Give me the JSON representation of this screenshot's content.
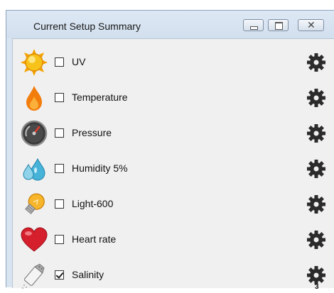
{
  "window": {
    "title": "Current Setup Summary",
    "buttons": {
      "minimize": "minimize",
      "maximize": "maximize",
      "close": "close"
    }
  },
  "colors": {
    "title_bar": "#d9e4f1",
    "client_bg": "#f0f0f0",
    "gear": "#2b2b2b"
  },
  "sensors": [
    {
      "label": "UV",
      "checked": false,
      "icon": "sun-icon"
    },
    {
      "label": "Temperature",
      "checked": false,
      "icon": "flame-icon"
    },
    {
      "label": "Pressure",
      "checked": false,
      "icon": "gauge-icon"
    },
    {
      "label": "Humidity 5%",
      "checked": false,
      "icon": "water-drops-icon"
    },
    {
      "label": "Light-600",
      "checked": false,
      "icon": "lightbulb-icon"
    },
    {
      "label": "Heart rate",
      "checked": false,
      "icon": "heart-icon"
    },
    {
      "label": "Salinity",
      "checked": true,
      "icon": "salt-shaker-icon"
    }
  ],
  "overlay": {
    "cursor_badge": "3"
  }
}
